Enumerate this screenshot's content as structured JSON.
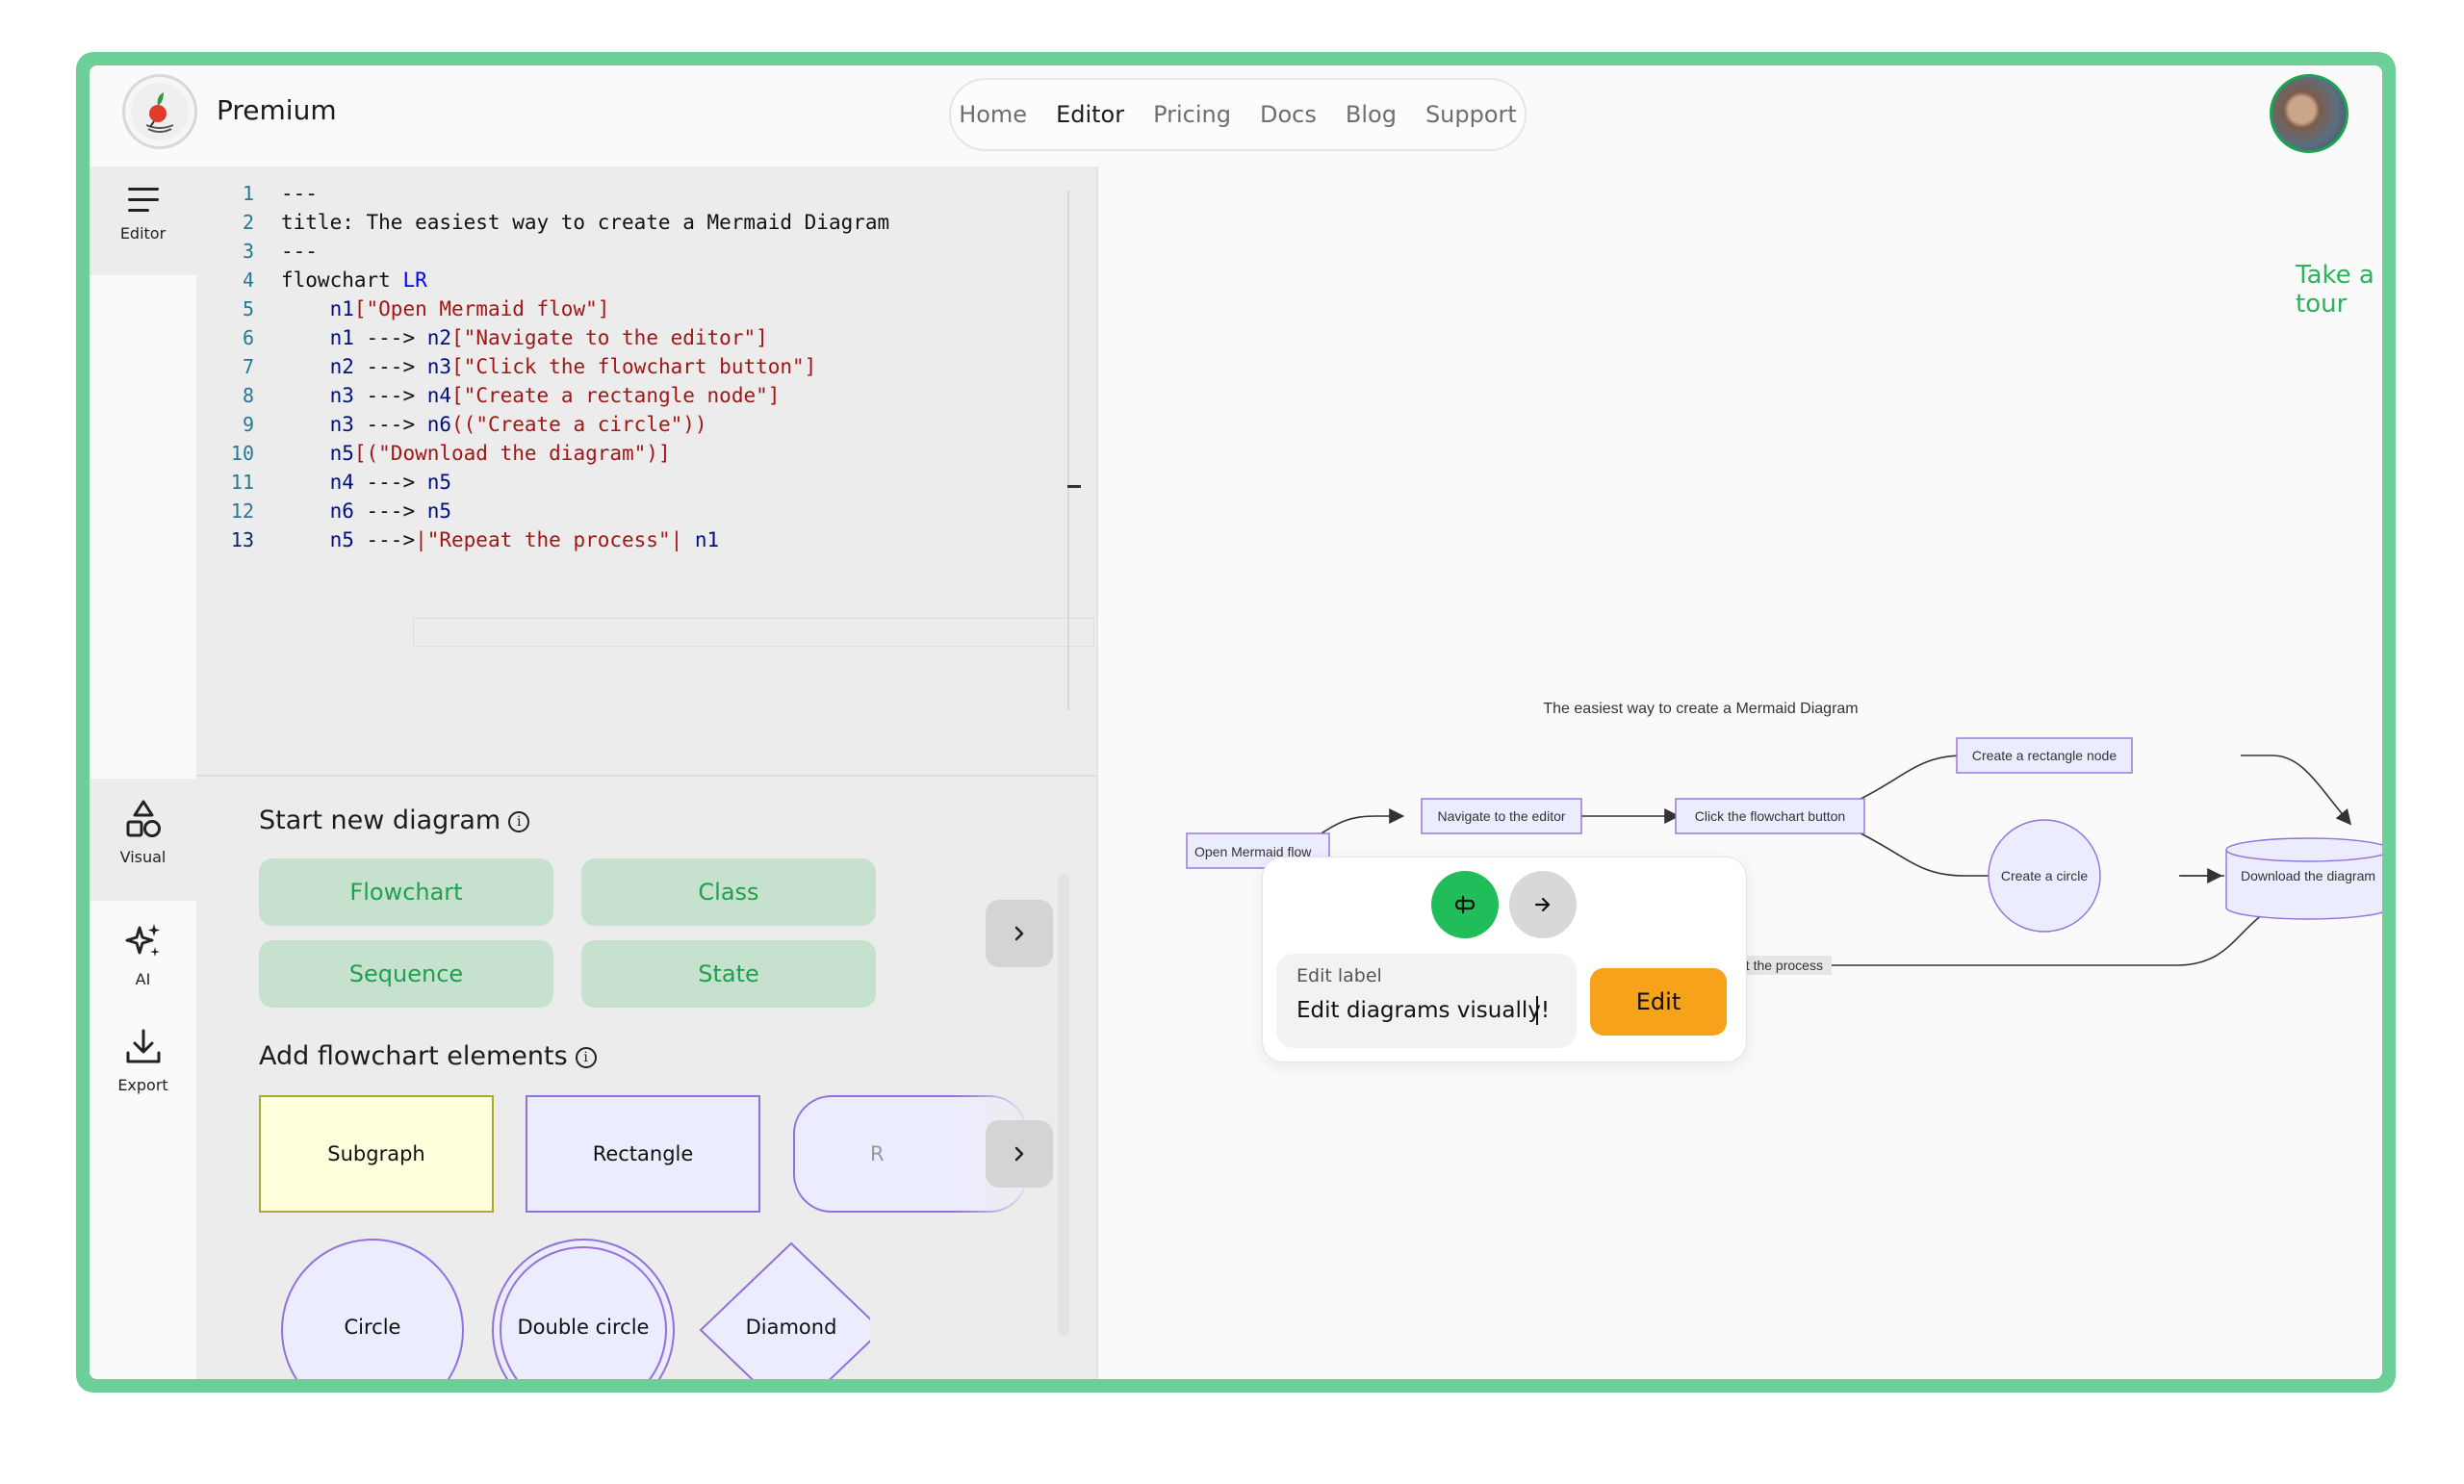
{
  "header": {
    "brand": "Premium",
    "nav": [
      "Home",
      "Editor",
      "Pricing",
      "Docs",
      "Blog",
      "Support"
    ],
    "active_nav": "Editor"
  },
  "rail": {
    "editor": "Editor",
    "visual": "Visual",
    "ai": "AI",
    "export": "Export"
  },
  "code": {
    "line_numbers": [
      "1",
      "2",
      "3",
      "4",
      "5",
      "6",
      "7",
      "8",
      "9",
      "10",
      "11",
      "12",
      "13"
    ],
    "lines": [
      [
        {
          "t": "---",
          "c": "plain"
        }
      ],
      [
        {
          "t": "title: The easiest way to create a Mermaid Diagram",
          "c": "plain"
        }
      ],
      [
        {
          "t": "---",
          "c": "plain"
        }
      ],
      [
        {
          "t": "flowchart ",
          "c": "plain"
        },
        {
          "t": "LR",
          "c": "kw"
        }
      ],
      [
        {
          "t": "    ",
          "c": "plain"
        },
        {
          "t": "n1",
          "c": "id"
        },
        {
          "t": "[\"Open Mermaid flow\"]",
          "c": "str"
        }
      ],
      [
        {
          "t": "    ",
          "c": "plain"
        },
        {
          "t": "n1",
          "c": "id"
        },
        {
          "t": " ---> ",
          "c": "plain"
        },
        {
          "t": "n2",
          "c": "id"
        },
        {
          "t": "[\"Navigate to the editor\"]",
          "c": "str"
        }
      ],
      [
        {
          "t": "    ",
          "c": "plain"
        },
        {
          "t": "n2",
          "c": "id"
        },
        {
          "t": " ---> ",
          "c": "plain"
        },
        {
          "t": "n3",
          "c": "id"
        },
        {
          "t": "[\"Click the flowchart button\"]",
          "c": "str"
        }
      ],
      [
        {
          "t": "    ",
          "c": "plain"
        },
        {
          "t": "n3",
          "c": "id"
        },
        {
          "t": " ---> ",
          "c": "plain"
        },
        {
          "t": "n4",
          "c": "id"
        },
        {
          "t": "[\"Create a rectangle node\"]",
          "c": "str"
        }
      ],
      [
        {
          "t": "    ",
          "c": "plain"
        },
        {
          "t": "n3",
          "c": "id"
        },
        {
          "t": " ---> ",
          "c": "plain"
        },
        {
          "t": "n6",
          "c": "id"
        },
        {
          "t": "((\"Create a circle\"))",
          "c": "str"
        }
      ],
      [
        {
          "t": "    ",
          "c": "plain"
        },
        {
          "t": "n5",
          "c": "id"
        },
        {
          "t": "[(\"Download the diagram\")]",
          "c": "str"
        }
      ],
      [
        {
          "t": "    ",
          "c": "plain"
        },
        {
          "t": "n4",
          "c": "id"
        },
        {
          "t": " ---> ",
          "c": "plain"
        },
        {
          "t": "n5",
          "c": "id"
        }
      ],
      [
        {
          "t": "    ",
          "c": "plain"
        },
        {
          "t": "n6",
          "c": "id"
        },
        {
          "t": " ---> ",
          "c": "plain"
        },
        {
          "t": "n5",
          "c": "id"
        }
      ],
      [
        {
          "t": "    ",
          "c": "plain"
        },
        {
          "t": "n5",
          "c": "id"
        },
        {
          "t": " --->",
          "c": "plain"
        },
        {
          "t": "|\"Repeat the process\"|",
          "c": "str"
        },
        {
          "t": " ",
          "c": "plain"
        },
        {
          "t": "n1",
          "c": "id"
        }
      ]
    ]
  },
  "start_new": {
    "title": "Start new diagram",
    "buttons": [
      "Flowchart",
      "Class",
      "Sequence",
      "State"
    ]
  },
  "add_elements": {
    "title": "Add flowchart elements",
    "boxes": [
      "Subgraph",
      "Rectangle",
      "R"
    ],
    "shapes": [
      "Circle",
      "Double circle",
      "Diamond"
    ]
  },
  "canvas": {
    "take_tour": "Take a tour",
    "diagram_title": "The easiest way to create a Mermaid Diagram",
    "nodes": {
      "n1": "Open Mermaid flow",
      "n2": "Navigate to the editor",
      "n3": "Click the flowchart button",
      "n4": "Create a rectangle node",
      "n6": "Create a circle",
      "n5": "Download the diagram"
    },
    "edge_label_visible": "at the process"
  },
  "popup": {
    "field_label": "Edit label",
    "field_value": "Edit diagrams visually!",
    "edit_button": "Edit"
  },
  "colors": {
    "brand_green": "#6ccf97",
    "accent_green": "#22bd5b",
    "edit_orange": "#f6a21a",
    "node_fill": "#ececff",
    "node_stroke": "#9370db",
    "subgraph_fill": "#ffffde",
    "subgraph_stroke": "#aaaa33"
  }
}
